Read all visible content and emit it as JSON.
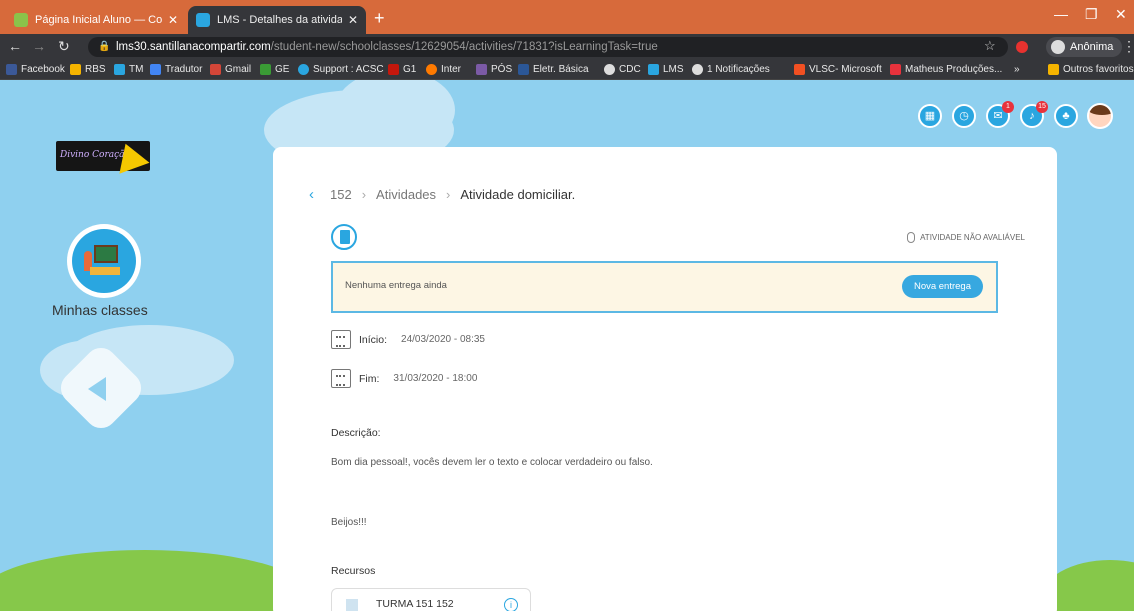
{
  "browser": {
    "tabs": [
      {
        "title": "Página Inicial Aluno — Compart",
        "favicon_color": "#8bc34a"
      },
      {
        "title": "LMS - Detalhes da atividade",
        "favicon_color": "#2aa6e0"
      }
    ],
    "url_host": "lms30.santillanacompartir.com",
    "url_path": "/student-new/schoolclasses/12629054/activities/71831?isLearningTask=true",
    "profile_label": "Anônima",
    "bookmarks": [
      "Facebook",
      "RBS",
      "TM",
      "Tradutor",
      "Gmail",
      "GE",
      "Support : ACSC",
      "G1",
      "Inter",
      "PÓS",
      "Eletr. Básica",
      "CDC",
      "LMS",
      "1 Notificações",
      "VLSC- Microsoft",
      "Matheus Produções...",
      "»",
      "Outros favoritos"
    ]
  },
  "sidebar": {
    "logo_text": "Divino Coração",
    "classes_label": "Minhas classes"
  },
  "header_icons": {
    "messages_badge": "1",
    "notifications_badge": "15"
  },
  "activity": {
    "breadcrumb": {
      "class": "152",
      "section": "Atividades",
      "current": "Atividade domiciliar."
    },
    "not_evaluable": "ATIVIDADE NÃO AVALIÁVEL",
    "delivery_status": "Nenhuma entrega ainda",
    "new_delivery_label": "Nova entrega",
    "start_label": "Início:",
    "start_value": "24/03/2020 - 08:35",
    "end_label": "Fim:",
    "end_value": "31/03/2020 - 18:00",
    "description_title": "Descrição:",
    "description_line1": "Bom dia pessoal!, vocês devem ler o texto e colocar verdadeiro ou falso.",
    "description_line2": "Beijos!!!",
    "resources_title": "Recursos",
    "resource_name": "TURMA 151 152"
  }
}
